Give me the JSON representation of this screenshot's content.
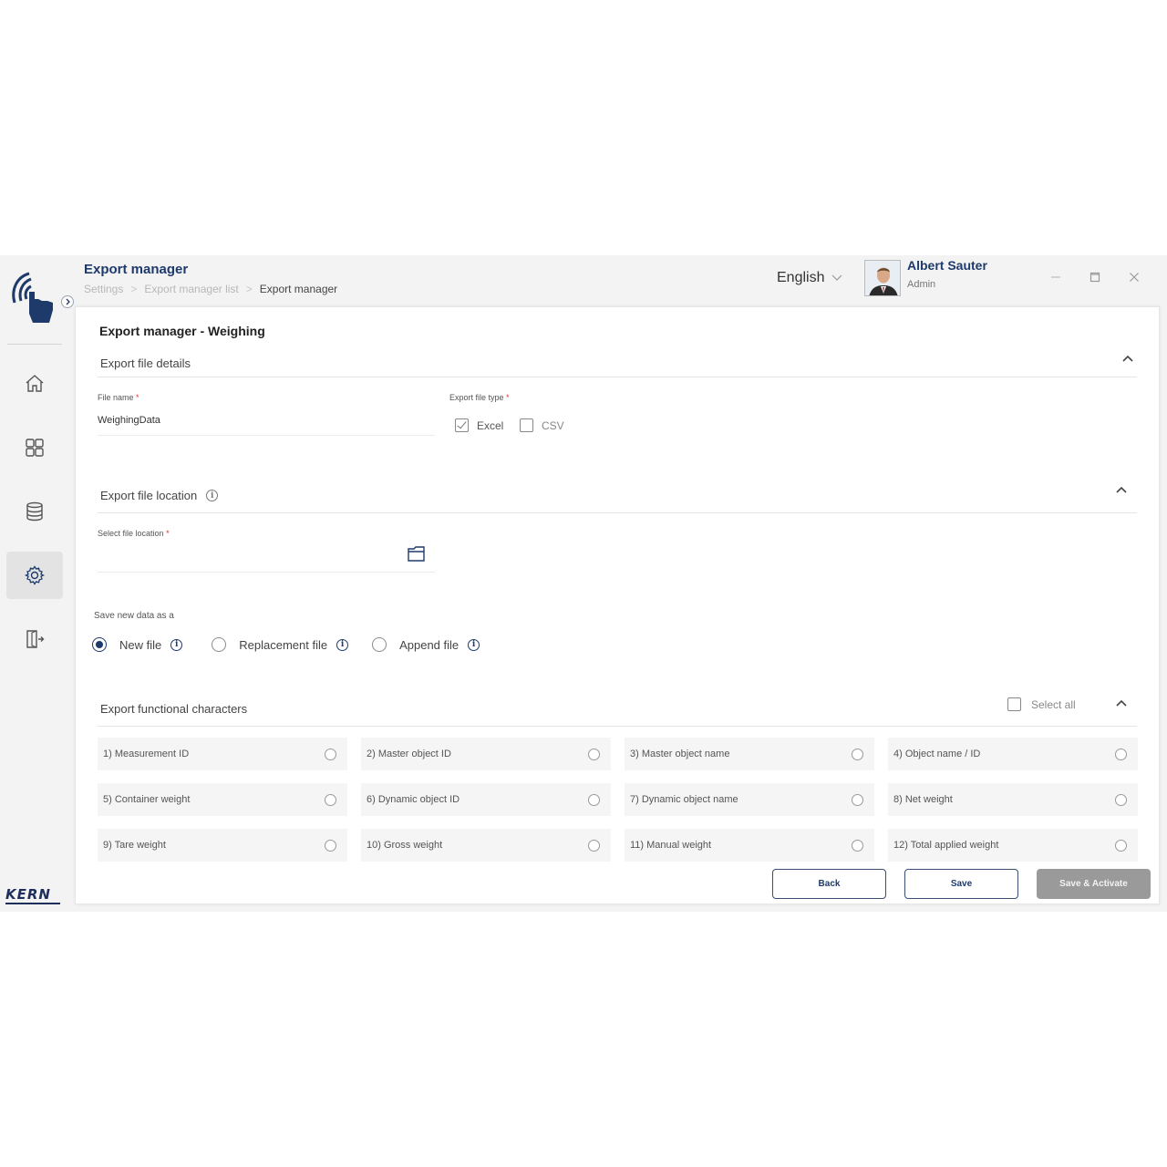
{
  "header": {
    "title": "Export manager",
    "breadcrumb": [
      "Settings",
      "Export manager list",
      "Export manager"
    ],
    "language": "English",
    "user_name": "Albert Sauter",
    "user_role": "Admin"
  },
  "sidebar": {
    "items": [
      "home-icon",
      "dashboard-icon",
      "database-icon",
      "settings-icon",
      "logout-icon"
    ],
    "active": "settings-icon",
    "brand": "KERN"
  },
  "card": {
    "title": "Export manager - Weighing",
    "file_details": {
      "heading": "Export file details",
      "file_name_label": "File name",
      "file_name_value": "WeighingData",
      "type_label": "Export file type",
      "options": [
        {
          "label": "Excel",
          "checked": true
        },
        {
          "label": "CSV",
          "checked": false
        }
      ]
    },
    "location": {
      "heading": "Export file location",
      "select_label": "Select file location",
      "value": ""
    },
    "save_mode": {
      "label": "Save new data as a",
      "options": [
        {
          "label": "New file",
          "selected": true
        },
        {
          "label": "Replacement file",
          "selected": false
        },
        {
          "label": "Append file",
          "selected": false
        }
      ]
    },
    "characters": {
      "heading": "Export functional characters",
      "select_all": "Select all",
      "items": [
        "1) Measurement ID",
        "2) Master object ID",
        "3) Master object name",
        "4) Object name / ID",
        "5) Container weight",
        "6) Dynamic object ID",
        "7) Dynamic object name",
        "8) Net weight",
        "9) Tare weight",
        "10) Gross weight",
        "11) Manual weight",
        "12) Total applied weight"
      ]
    },
    "buttons": {
      "back": "Back",
      "save": "Save",
      "save_activate": "Save & Activate"
    }
  },
  "colors": {
    "brand": "#1e3a6b",
    "required": "#dd3333",
    "primary_disabled": "#9a9a9a"
  }
}
